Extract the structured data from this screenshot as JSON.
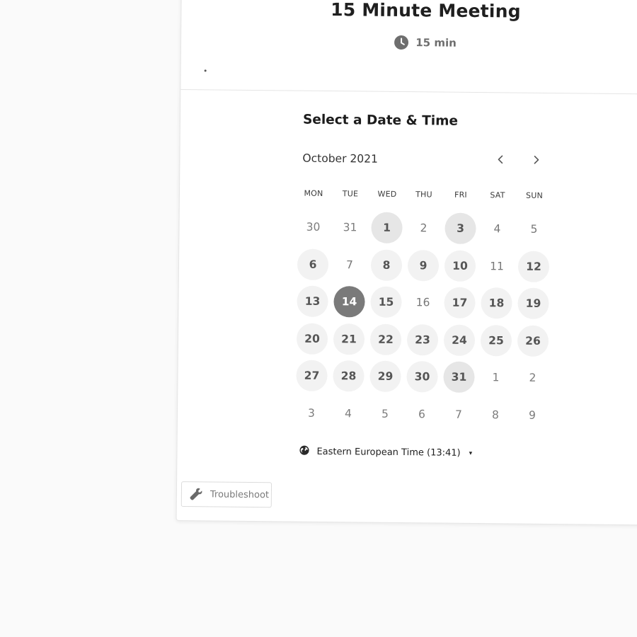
{
  "event": {
    "title": "15 Minute Meeting",
    "duration": "15 min",
    "description_marker": "."
  },
  "picker": {
    "section_title": "Select a Date & Time",
    "month_label": "October 2021",
    "prev_icon": "chevron-left-icon",
    "next_icon": "chevron-right-icon",
    "weekdays": [
      "MON",
      "TUE",
      "WED",
      "THU",
      "FRI",
      "SAT",
      "SUN"
    ],
    "days": [
      {
        "label": "30",
        "state": "outside"
      },
      {
        "label": "31",
        "state": "outside"
      },
      {
        "label": "1",
        "state": "available-highlight"
      },
      {
        "label": "2",
        "state": "unavailable"
      },
      {
        "label": "3",
        "state": "available-highlight"
      },
      {
        "label": "4",
        "state": "unavailable"
      },
      {
        "label": "5",
        "state": "unavailable"
      },
      {
        "label": "6",
        "state": "available"
      },
      {
        "label": "7",
        "state": "unavailable"
      },
      {
        "label": "8",
        "state": "available"
      },
      {
        "label": "9",
        "state": "available"
      },
      {
        "label": "10",
        "state": "available"
      },
      {
        "label": "11",
        "state": "unavailable"
      },
      {
        "label": "12",
        "state": "available"
      },
      {
        "label": "13",
        "state": "available"
      },
      {
        "label": "14",
        "state": "selected"
      },
      {
        "label": "15",
        "state": "available"
      },
      {
        "label": "16",
        "state": "unavailable"
      },
      {
        "label": "17",
        "state": "available"
      },
      {
        "label": "18",
        "state": "available"
      },
      {
        "label": "19",
        "state": "available"
      },
      {
        "label": "20",
        "state": "available"
      },
      {
        "label": "21",
        "state": "available"
      },
      {
        "label": "22",
        "state": "available"
      },
      {
        "label": "23",
        "state": "available"
      },
      {
        "label": "24",
        "state": "available"
      },
      {
        "label": "25",
        "state": "available"
      },
      {
        "label": "26",
        "state": "available"
      },
      {
        "label": "27",
        "state": "available"
      },
      {
        "label": "28",
        "state": "available"
      },
      {
        "label": "29",
        "state": "available"
      },
      {
        "label": "30",
        "state": "available"
      },
      {
        "label": "31",
        "state": "available-highlight"
      },
      {
        "label": "1",
        "state": "outside"
      },
      {
        "label": "2",
        "state": "outside"
      },
      {
        "label": "3",
        "state": "outside"
      },
      {
        "label": "4",
        "state": "outside"
      },
      {
        "label": "5",
        "state": "outside"
      },
      {
        "label": "6",
        "state": "outside"
      },
      {
        "label": "7",
        "state": "outside"
      },
      {
        "label": "8",
        "state": "outside"
      },
      {
        "label": "9",
        "state": "outside"
      }
    ]
  },
  "timezone": {
    "icon": "globe-icon",
    "label": "Eastern European Time (13:41)",
    "caret": "▾"
  },
  "troubleshoot": {
    "icon": "wrench-icon",
    "label": "Troubleshoot"
  },
  "colors": {
    "page_bg": "#fafafa",
    "card_bg": "#ffffff",
    "available_bg": "#f2f2f2",
    "selected_bg": "#7a7a7a"
  }
}
